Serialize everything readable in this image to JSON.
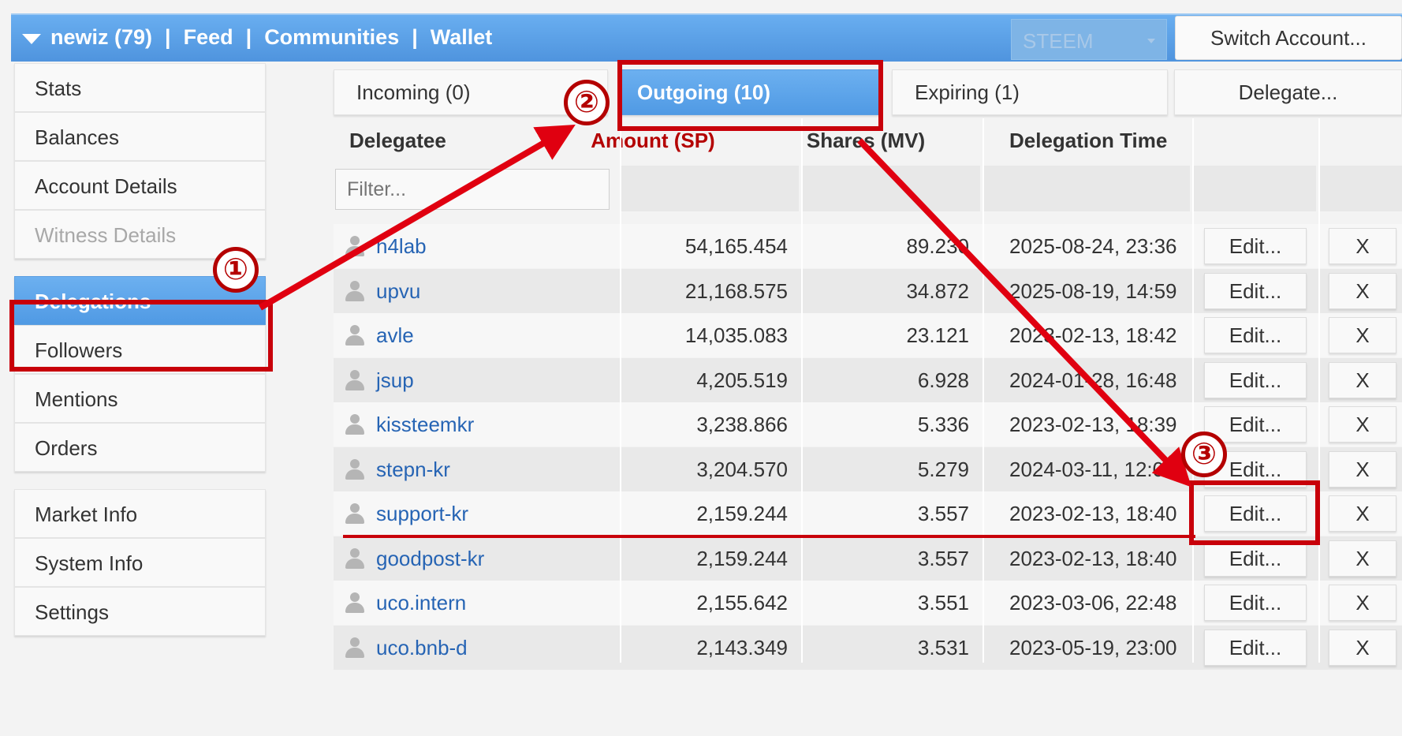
{
  "topbar": {
    "user": "newiz (79)",
    "feed": "Feed",
    "communities": "Communities",
    "wallet": "Wallet",
    "separator": "|",
    "chain": "STEEM",
    "switch_account": "Switch Account..."
  },
  "sidebar": {
    "items": [
      {
        "label": "Stats"
      },
      {
        "label": "Balances"
      },
      {
        "label": "Account Details"
      },
      {
        "label": "Witness Details"
      },
      {
        "label": "Delegations"
      },
      {
        "label": "Followers"
      },
      {
        "label": "Mentions"
      },
      {
        "label": "Orders"
      },
      {
        "label": "Market Info"
      },
      {
        "label": "System Info"
      },
      {
        "label": "Settings"
      }
    ]
  },
  "tabs": {
    "incoming": "Incoming (0)",
    "outgoing": "Outgoing (10)",
    "expiring": "Expiring (1)",
    "delegate": "Delegate..."
  },
  "table": {
    "headers": {
      "delegatee": "Delegatee",
      "amount": "Amount (SP)",
      "shares": "Shares (MV)",
      "time": "Delegation Time"
    },
    "filter_placeholder": "Filter...",
    "edit_label": "Edit...",
    "remove_label": "X",
    "rows": [
      {
        "name": "h4lab",
        "amount": "54,165.454",
        "shares": "89.230",
        "time": "2025-08-24, 23:36"
      },
      {
        "name": "upvu",
        "amount": "21,168.575",
        "shares": "34.872",
        "time": "2025-08-19, 14:59"
      },
      {
        "name": "avle",
        "amount": "14,035.083",
        "shares": "23.121",
        "time": "2023-02-13, 18:42"
      },
      {
        "name": "jsup",
        "amount": "4,205.519",
        "shares": "6.928",
        "time": "2024-01-28, 16:48"
      },
      {
        "name": "kissteemkr",
        "amount": "3,238.866",
        "shares": "5.336",
        "time": "2023-02-13, 18:39"
      },
      {
        "name": "stepn-kr",
        "amount": "3,204.570",
        "shares": "5.279",
        "time": "2024-03-11, 12:08"
      },
      {
        "name": "support-kr",
        "amount": "2,159.244",
        "shares": "3.557",
        "time": "2023-02-13, 18:40"
      },
      {
        "name": "goodpost-kr",
        "amount": "2,159.244",
        "shares": "3.557",
        "time": "2023-02-13, 18:40"
      },
      {
        "name": "uco.intern",
        "amount": "2,155.642",
        "shares": "3.551",
        "time": "2023-03-06, 22:48"
      },
      {
        "name": "uco.bnb-d",
        "amount": "2,143.349",
        "shares": "3.531",
        "time": "2023-05-19, 23:00"
      }
    ]
  },
  "annotations": {
    "step1": "①",
    "step2": "②",
    "step3": "③",
    "color": "#c8000a"
  },
  "colors": {
    "accent": "#509ae4",
    "link": "#2664b4",
    "amount_header": "#b40000"
  }
}
